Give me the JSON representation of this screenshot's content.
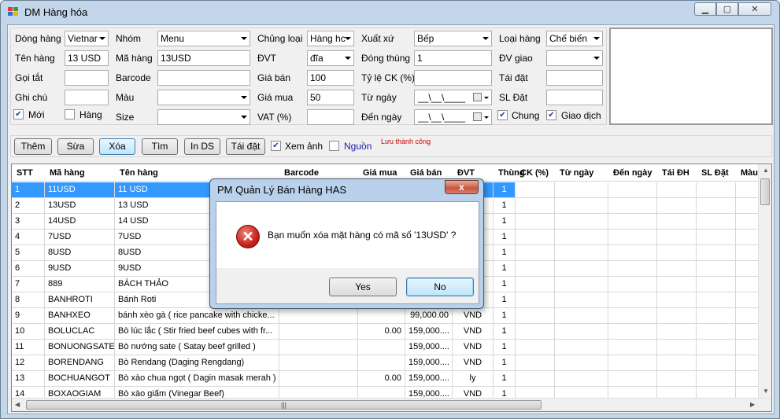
{
  "window": {
    "title": "DM Hàng hóa"
  },
  "form": {
    "dong_hang": {
      "label": "Dòng hàng",
      "value": "Vietnar"
    },
    "ten_hang": {
      "label": "Tên hàng",
      "value": "13 USD"
    },
    "goi_tat": {
      "label": "Gọi tắt",
      "value": ""
    },
    "ghi_chu": {
      "label": "Ghi chú",
      "value": ""
    },
    "moi": {
      "label": "Mới",
      "checked": true
    },
    "nhom": {
      "label": "Nhóm",
      "value": "Menu"
    },
    "ma_hang": {
      "label": "Mã hàng",
      "value": "13USD"
    },
    "barcode": {
      "label": "Barcode",
      "value": ""
    },
    "mau": {
      "label": "Màu",
      "value": ""
    },
    "hang": {
      "label": "Hàng",
      "checked": false
    },
    "size": {
      "label": "Size",
      "value": ""
    },
    "chung_loai": {
      "label": "Chủng loại",
      "value": "Hàng hc"
    },
    "dvt": {
      "label": "ĐVT",
      "value": "đĩa"
    },
    "gia_ban": {
      "label": "Giá bán",
      "value": "100"
    },
    "gia_mua": {
      "label": "Giá mua",
      "value": "50"
    },
    "vat": {
      "label": "VAT (%)",
      "value": ""
    },
    "xuat_xu": {
      "label": "Xuất xứ",
      "value": "Bếp"
    },
    "dong_thung": {
      "label": "Đóng thùng",
      "value": "1"
    },
    "ty_le_ck": {
      "label": "Tỷ lệ CK (%)",
      "value": ""
    },
    "tu_ngay": {
      "label": "Từ ngày",
      "value": "__\\__\\____"
    },
    "den_ngay": {
      "label": "Đến ngày",
      "value": "__\\__\\____"
    },
    "loai_hang": {
      "label": "Loại hàng",
      "value": "Chế biến"
    },
    "dv_giao": {
      "label": "ĐV giao",
      "value": ""
    },
    "tai_dat": {
      "label": "Tái đặt",
      "value": ""
    },
    "sl_dat": {
      "label": "SL Đặt",
      "value": ""
    },
    "chung": {
      "label": "Chung",
      "checked": true
    },
    "giao_dich": {
      "label": "Giao dịch",
      "checked": true
    }
  },
  "toolbar": {
    "them": "Thêm",
    "sua": "Sừa",
    "xoa": "Xóa",
    "tim": "Tìm",
    "in_ds": "In DS",
    "tai_dat": "Tái đặt",
    "xem_anh": {
      "label": "Xem ảnh",
      "checked": true
    },
    "nguon": {
      "label": "Nguồn",
      "checked": false
    },
    "status": "Lưu thành công"
  },
  "grid": {
    "columns": [
      "STT",
      "Mã hàng",
      "Tên hàng",
      "Barcode",
      "Giá mua",
      "Giá bán",
      "ĐVT",
      "Thùng",
      "CK (%)",
      "Từ ngày",
      "Đến ngày",
      "Tái ĐH",
      "SL Đặt",
      "Màu"
    ],
    "rows": [
      [
        "1",
        "11USD",
        "11 USD",
        "",
        "",
        "",
        "",
        "1"
      ],
      [
        "2",
        "13USD",
        "13 USD",
        "",
        "",
        "",
        "",
        "1"
      ],
      [
        "3",
        "14USD",
        "14 USD",
        "",
        "",
        "",
        "",
        "1"
      ],
      [
        "4",
        "7USD",
        "7USD",
        "",
        "",
        "",
        "",
        "1"
      ],
      [
        "5",
        "8USD",
        "8USD",
        "",
        "",
        "",
        "",
        "1"
      ],
      [
        "6",
        "9USD",
        "9USD",
        "",
        "",
        "",
        "",
        "1"
      ],
      [
        "7",
        "889",
        "BÁCH THẢO",
        "",
        "",
        "",
        "",
        "1"
      ],
      [
        "8",
        "BANHROTI",
        "Bánh Roti",
        "",
        "",
        "",
        "",
        "1"
      ],
      [
        "9",
        "BANHXEO",
        "bánh xèo gà ( rice pancake with chicke...",
        "",
        "",
        "99,000.00",
        "VND",
        "1"
      ],
      [
        "10",
        "BOLUCLAC",
        "Bò lúc lắc ( Stir fried beef cubes with fr...",
        "",
        "0.00",
        "159,000....",
        "VND",
        "1"
      ],
      [
        "11",
        "BONUONGSATE",
        "Bò nướng sate ( Satay beef grilled )",
        "",
        "",
        "159,000....",
        "VND",
        "1"
      ],
      [
        "12",
        "BORENDANG",
        "Bò Rendang (Daging Rengdang)",
        "",
        "",
        "159,000....",
        "VND",
        "1"
      ],
      [
        "13",
        "BOCHUANGOT",
        "Bò xào chua ngọt ( Dagin masak merah )",
        "",
        "0.00",
        "159,000....",
        "ly",
        "1"
      ],
      [
        "14",
        "BOXAOGIAM",
        "Bò xào giấm (Vinegar Beef)",
        "",
        "",
        "159,000....",
        "VND",
        "1"
      ]
    ]
  },
  "dialog": {
    "title": "PM Quản Lý Bán Hàng HAS",
    "close": "x",
    "message": "Bạn muốn xóa mặt hàng có mã số '13USD' ?",
    "yes": "Yes",
    "no": "No",
    "icon": "error-icon"
  }
}
